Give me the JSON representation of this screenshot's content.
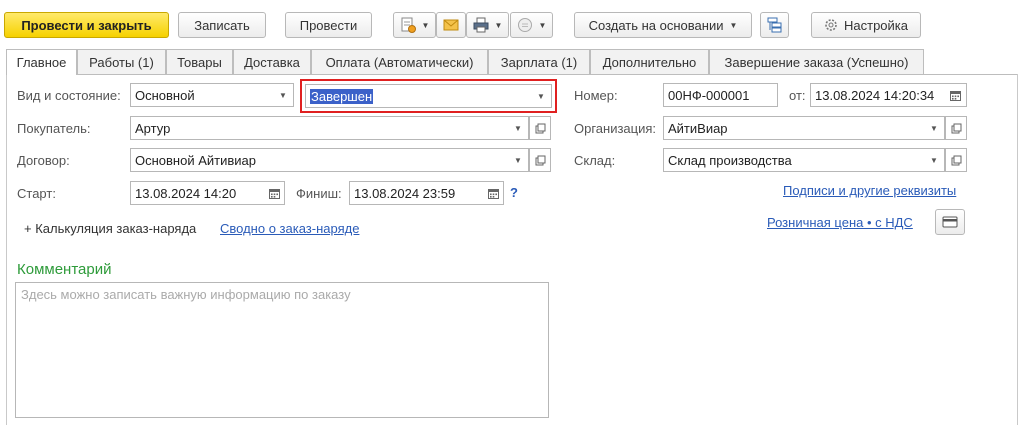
{
  "toolbar": {
    "post_and_close": "Провести и закрыть",
    "save": "Записать",
    "post": "Провести",
    "create_based_on": "Создать на основании",
    "settings": "Настройка"
  },
  "tabs": [
    {
      "label": "Главное",
      "active": true
    },
    {
      "label": "Работы (1)"
    },
    {
      "label": "Товары"
    },
    {
      "label": "Доставка"
    },
    {
      "label": "Оплата (Автоматически)"
    },
    {
      "label": "Зарплата (1)"
    },
    {
      "label": "Дополнительно"
    },
    {
      "label": "Завершение заказа (Успешно)"
    }
  ],
  "form": {
    "kind_state_label": "Вид и состояние:",
    "kind_value": "Основной",
    "state_value": "Завершен",
    "buyer_label": "Покупатель:",
    "buyer_value": "Артур",
    "contract_label": "Договор:",
    "contract_value": "Основной Айтивиар",
    "start_label": "Старт:",
    "start_value": "13.08.2024 14:20",
    "finish_label": "Финиш:",
    "finish_value": "13.08.2024 23:59",
    "help": "?",
    "number_label": "Номер:",
    "number_value": "00НФ-000001",
    "from_label": "от:",
    "from_value": "13.08.2024 14:20:34",
    "org_label": "Организация:",
    "org_value": "АйтиВиар",
    "warehouse_label": "Склад:",
    "warehouse_value": "Склад производства",
    "signatures_link": "Подписи и другие реквизиты",
    "retail_price_link": "Розничная цена • с НДС",
    "calc_label": "+ Калькуляция заказ-наряда",
    "summary_link": "Сводно о заказ-наряде",
    "comment_title": "Комментарий",
    "comment_placeholder": "Здесь можно записать важную информацию по заказу"
  },
  "colors": {
    "primary_button": "#f6d100",
    "highlight_border": "#e02020",
    "link": "#2a5bb8",
    "comment_title": "#2e9b3a",
    "selection": "#3b61c9"
  },
  "icons": [
    "report-icon",
    "mail-icon",
    "print-icon",
    "circle-icon",
    "structure-icon",
    "gear-icon",
    "calendar-icon",
    "open-icon",
    "card-icon"
  ]
}
